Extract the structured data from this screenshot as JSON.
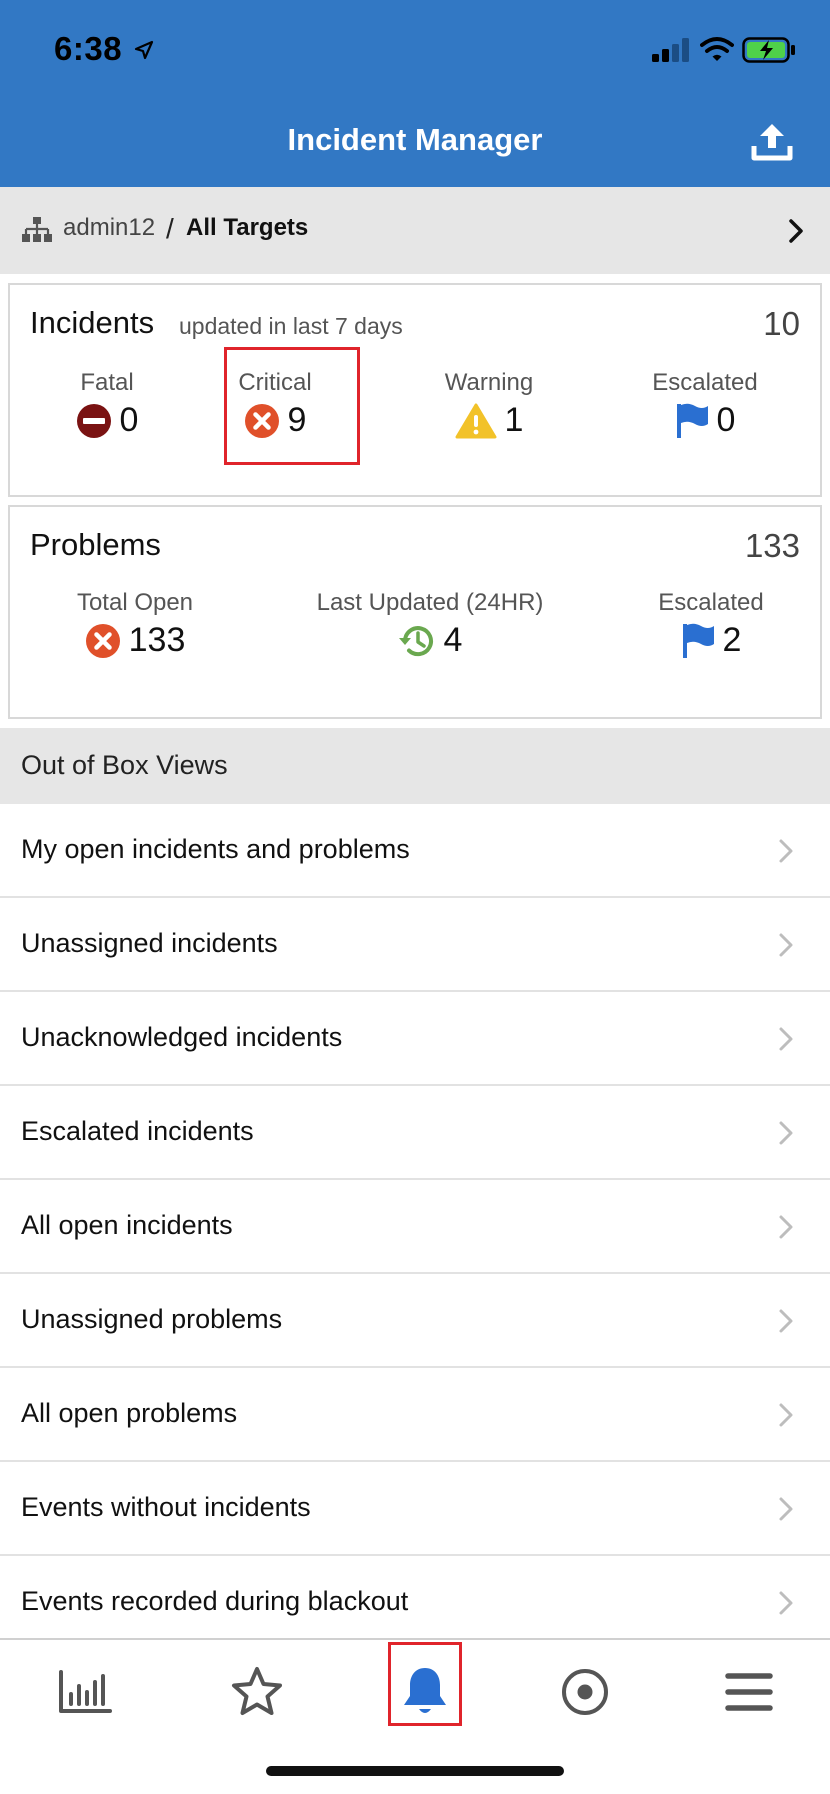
{
  "status_bar": {
    "time": "6:38"
  },
  "header": {
    "title": "Incident Manager"
  },
  "breadcrumb": {
    "user": "admin12",
    "separator": "/",
    "target": "All Targets"
  },
  "incidents": {
    "title": "Incidents",
    "subtitle": "updated in last 7 days",
    "total": "10",
    "metrics": [
      {
        "label": "Fatal",
        "value": "0",
        "icon": "fatal-icon"
      },
      {
        "label": "Critical",
        "value": "9",
        "icon": "critical-icon"
      },
      {
        "label": "Warning",
        "value": "1",
        "icon": "warning-icon"
      },
      {
        "label": "Escalated",
        "value": "0",
        "icon": "flag-icon"
      }
    ]
  },
  "problems": {
    "title": "Problems",
    "total": "133",
    "metrics": [
      {
        "label": "Total Open",
        "value": "133",
        "icon": "critical-icon"
      },
      {
        "label": "Last Updated (24HR)",
        "value": "4",
        "icon": "history-icon"
      },
      {
        "label": "Escalated",
        "value": "2",
        "icon": "flag-icon"
      }
    ]
  },
  "views": {
    "title": "Out of Box Views",
    "items": [
      "My open incidents and problems",
      "Unassigned incidents",
      "Unacknowledged incidents",
      "Escalated incidents",
      "All open incidents",
      "Unassigned problems",
      "All open problems",
      "Events without incidents",
      "Events recorded during blackout"
    ]
  },
  "tabs": [
    {
      "icon": "bar-chart-icon"
    },
    {
      "icon": "star-icon"
    },
    {
      "icon": "bell-icon",
      "active": true
    },
    {
      "icon": "target-icon"
    },
    {
      "icon": "menu-icon"
    }
  ],
  "colors": {
    "header_blue": "#3278c4",
    "critical_red": "#e0502a",
    "fatal_maroon": "#7a1212",
    "warning_yellow": "#f2c229",
    "flag_blue": "#2a6fd1",
    "history_green": "#6aa84f",
    "highlight_red": "#e0242b"
  }
}
